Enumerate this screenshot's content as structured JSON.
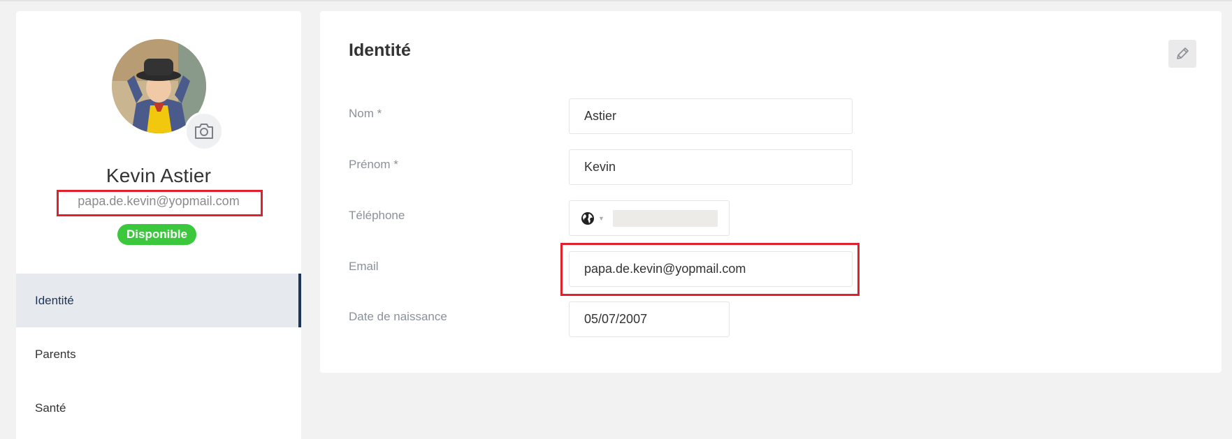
{
  "profile": {
    "name": "Kevin Astier",
    "email": "papa.de.kevin@yopmail.com",
    "status": "Disponible",
    "avatar_icon": "child-photo",
    "camera_icon": "camera-icon"
  },
  "nav": {
    "items": [
      {
        "label": "Identité",
        "active": true
      },
      {
        "label": "Parents",
        "active": false
      },
      {
        "label": "Santé",
        "active": false
      }
    ]
  },
  "identity": {
    "title": "Identité",
    "edit_icon": "pencil-icon",
    "fields": {
      "nom": {
        "label": "Nom *",
        "value": "Astier"
      },
      "prenom": {
        "label": "Prénom *",
        "value": "Kevin"
      },
      "telephone": {
        "label": "Téléphone",
        "value": ""
      },
      "email": {
        "label": "Email",
        "value": "papa.de.kevin@yopmail.com"
      },
      "naissance": {
        "label": "Date de naissance",
        "value": "05/07/2007"
      }
    }
  },
  "colors": {
    "accent": "#1d3557",
    "status_green": "#3cc83c",
    "highlight_red": "#e0202a"
  }
}
